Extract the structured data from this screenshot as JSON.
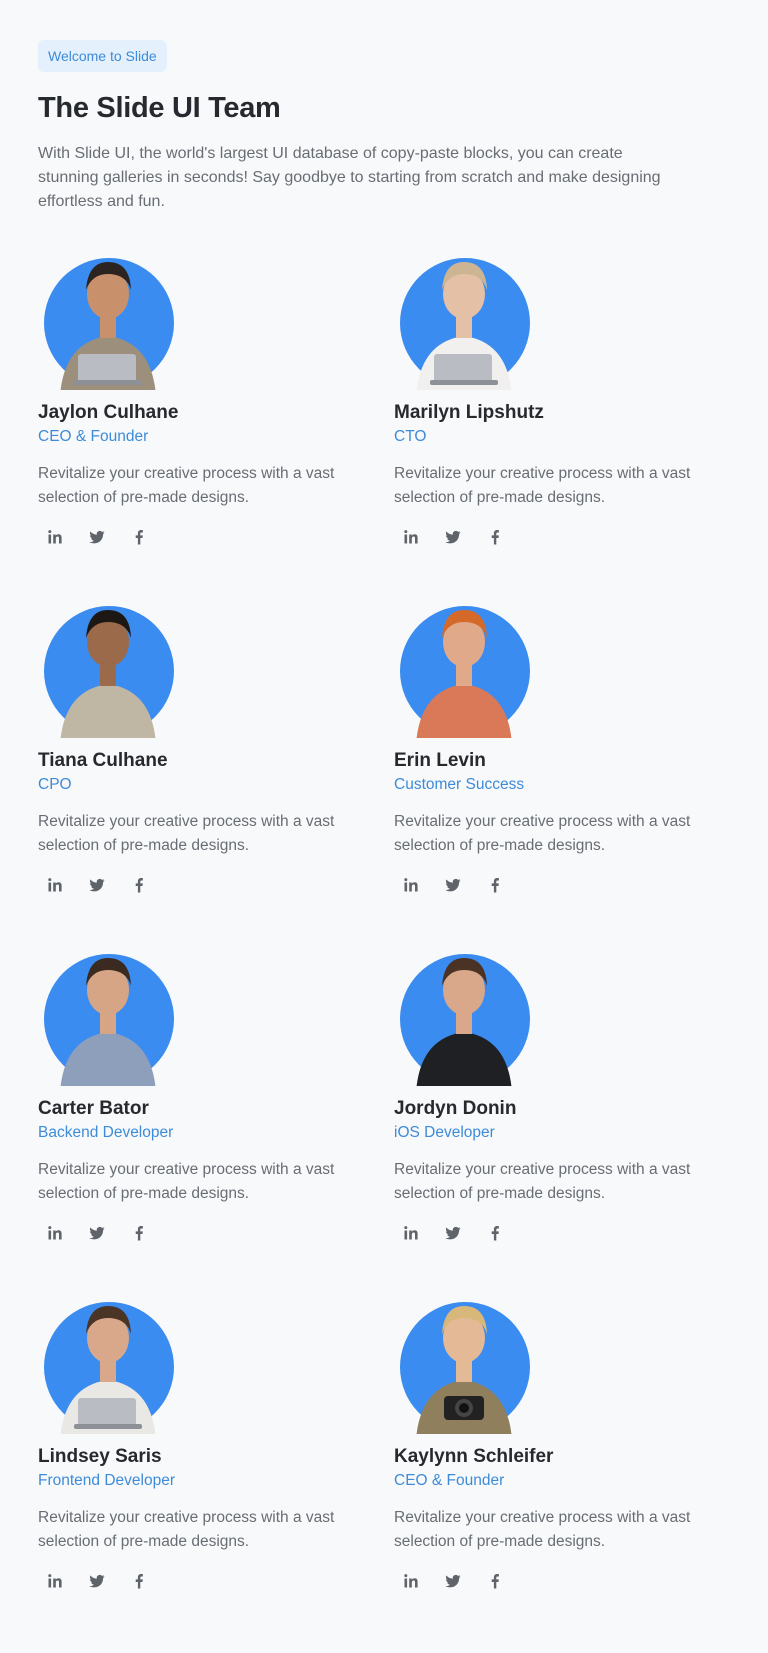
{
  "header": {
    "badge": "Welcome to Slide",
    "title": "The Slide UI Team",
    "intro": "With Slide UI, the world's largest UI database of copy-paste blocks, you can create stunning galleries in seconds! Say goodbye to starting from scratch and make designing effortless and fun."
  },
  "colors": {
    "accent": "#3d8bd9",
    "avatar_bg": "#3b8cf0",
    "badge_bg": "#e4f0fb"
  },
  "social_icons": [
    "linkedin-icon",
    "twitter-icon",
    "facebook-icon"
  ],
  "team": [
    {
      "name": "Jaylon Culhane",
      "role": "CEO & Founder",
      "bio": "Revitalize your creative process with a vast selection of pre-made designs.",
      "skin": "#c9916b",
      "hair": "#2b2420",
      "top": "#9c8f7b",
      "accessory": "laptop"
    },
    {
      "name": "Marilyn Lipshutz",
      "role": "CTO",
      "bio": "Revitalize your creative process with a vast selection of pre-made designs.",
      "skin": "#e3c0a6",
      "hair": "#cdb493",
      "top": "#f1f0ee",
      "accessory": "laptop"
    },
    {
      "name": "Tiana Culhane",
      "role": "CPO",
      "bio": "Revitalize your creative process with a vast selection of pre-made designs.",
      "skin": "#9b6a4b",
      "hair": "#1e1814",
      "top": "#bfb6a4",
      "accessory": "none"
    },
    {
      "name": "Erin Levin",
      "role": "Customer Success",
      "bio": "Revitalize your creative process with a vast selection of pre-made designs.",
      "skin": "#e0a98a",
      "hair": "#d5692a",
      "top": "#d97957",
      "accessory": "none"
    },
    {
      "name": "Carter Bator",
      "role": "Backend Developer",
      "bio": "Revitalize your creative process with a vast selection of pre-made designs.",
      "skin": "#d6a585",
      "hair": "#3a2a20",
      "top": "#8e9fbb",
      "accessory": "none"
    },
    {
      "name": "Jordyn Donin",
      "role": "iOS Developer",
      "bio": "Revitalize your creative process with a vast selection of pre-made designs.",
      "skin": "#d9a78a",
      "hair": "#4a3325",
      "top": "#1f2023",
      "accessory": "none"
    },
    {
      "name": "Lindsey Saris",
      "role": "Frontend Developer",
      "bio": "Revitalize your creative process with a vast selection of pre-made designs.",
      "skin": "#d9a88a",
      "hair": "#4a3426",
      "top": "#e9e8e4",
      "accessory": "laptop"
    },
    {
      "name": "Kaylynn Schleifer",
      "role": "CEO & Founder",
      "bio": "Revitalize your creative process with a vast selection of pre-made designs.",
      "skin": "#e4b996",
      "hair": "#d8b77a",
      "top": "#8f7f5c",
      "accessory": "camera"
    }
  ]
}
